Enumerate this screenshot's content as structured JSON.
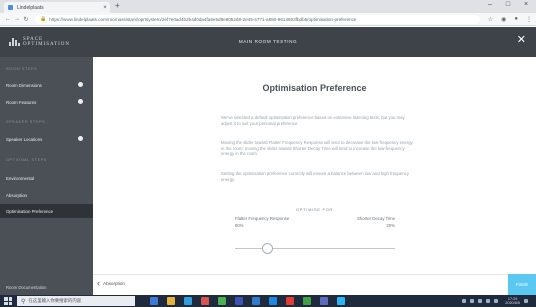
{
  "browser": {
    "tab_title": "Lindelplaats",
    "tab_close": "×",
    "new_tab": "+",
    "url": "https://www.lindelplaats.com/roomassistant/oprtsystem/2ef7e0ad4b2b4d0da4fa6e5d8e8052d8-2e45-4771-a890-9614803fbdb5/optimisation-preference",
    "window_minimize": "–",
    "window_maximize": "□",
    "window_close": "×"
  },
  "app": {
    "logo_text_line1": "SPACE",
    "logo_text_line2": "OPTIMISATION",
    "header_title": "MAIN ROOM TESTING",
    "close_glyph": "✕"
  },
  "sidebar": {
    "items": [
      {
        "type": "section",
        "label": "ROOM STEPS"
      },
      {
        "type": "link",
        "label": "Room Dimensions",
        "done": true
      },
      {
        "type": "link",
        "label": "Room Features",
        "done": true
      },
      {
        "type": "section",
        "label": "SPEAKER STEPS"
      },
      {
        "type": "link",
        "label": "Speaker Locations",
        "done": true
      },
      {
        "type": "section",
        "label": "OPTIONAL STEPS"
      },
      {
        "type": "link",
        "label": "Environmental",
        "done": false
      },
      {
        "type": "link",
        "label": "Absorption",
        "done": false
      },
      {
        "type": "link",
        "label": "Optimisation Preference",
        "done": false,
        "active": true
      }
    ],
    "bottom_link": "Room Documentation"
  },
  "main": {
    "title": "Optimisation Preference",
    "paragraphs": [
      "We've selected a default optimisation preference based on extensive listening tests, but you may adjust it to suit your personal preference.",
      "Moving the slider toward Flatter Frequency Response will tend to decrease the low-frequency energy in the room; moving the slider toward Shorter Decay Time will tend to increase the low-frequency energy in the room.",
      "Setting the optimisation preference correctly will ensure a balance between low and high frequency energy."
    ],
    "optimise_label": "OPTIMISE FOR",
    "left_label": "Flatter Frequency Response",
    "right_label": "Shorter Decay Time",
    "left_value": "80%",
    "right_value": "20%",
    "slider_position": 0.2
  },
  "footer": {
    "back_label": "Absorption",
    "back_glyph": "‹",
    "finish_label": "Finish"
  },
  "taskbar": {
    "search_placeholder": "在这里输入你要搜索的内容",
    "search_glyph": "⚲",
    "clock_time": "17:29",
    "clock_date": "2020/8/5"
  },
  "colors": {
    "header_bg": "#3e4349",
    "sidebar_bg": "#4b5057",
    "sidebar_active": "#2f3338",
    "finish_bg": "#5ac8f0",
    "taskbar_bg": "#1f2a3c"
  }
}
